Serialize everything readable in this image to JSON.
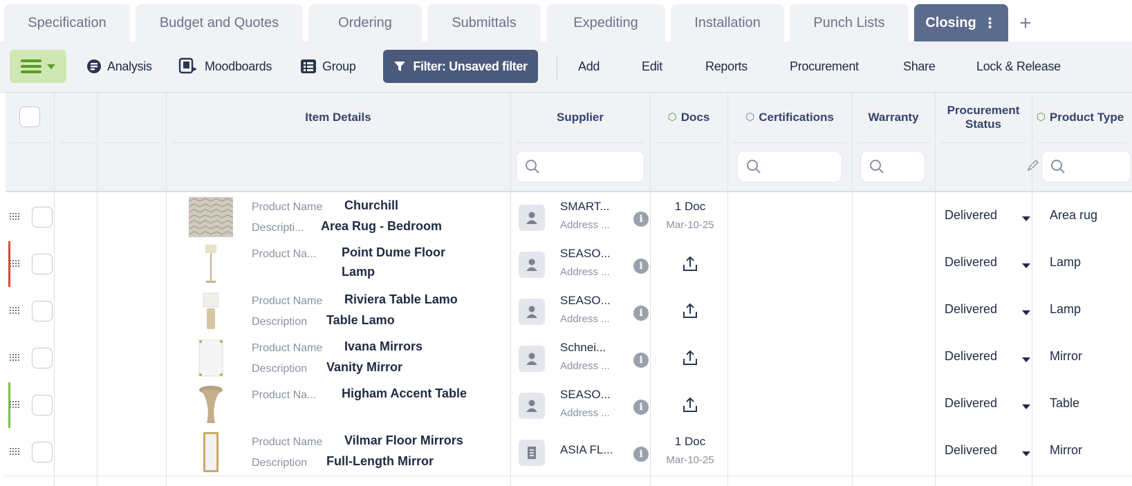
{
  "tabs": [
    {
      "label": "Specification"
    },
    {
      "label": "Budget and Quotes"
    },
    {
      "label": "Ordering"
    },
    {
      "label": "Submittals"
    },
    {
      "label": "Expediting"
    },
    {
      "label": "Installation"
    },
    {
      "label": "Punch Lists"
    },
    {
      "label": "Closing",
      "active": true
    }
  ],
  "tab_menu_glyph": "⋮",
  "add_tab_glyph": "+",
  "toolbar": {
    "analysis": "Analysis",
    "moodboards": "Moodboards",
    "group": "Group",
    "filter": "Filter: Unsaved filter",
    "add": "Add",
    "edit": "Edit",
    "reports": "Reports",
    "procurement": "Procurement",
    "share": "Share",
    "lock_release": "Lock & Release"
  },
  "columns": {
    "item_details": "Item Details",
    "supplier": "Supplier",
    "docs": "Docs",
    "certifications": "Certifications",
    "warranty": "Warranty",
    "procurement_status": "Procurement Status",
    "product_type": "Product Type"
  },
  "rows": [
    {
      "name_label": "Product Name",
      "name": "Churchill",
      "desc_label": "Descripti...",
      "desc": "Area Rug - Bedroom",
      "supplier": "SMART...",
      "supplier_addr": "Address ...",
      "supplier_icon": "person-icon",
      "doc_count": "1 Doc",
      "doc_date": "Mar-10-25",
      "status": "Delivered",
      "type": "Area rug",
      "accent": "",
      "thumb": "rug"
    },
    {
      "name_label": "Product Na...",
      "name": "Point Dume Floor Lamp",
      "desc_label": "",
      "desc": "",
      "supplier": "SEASO...",
      "supplier_addr": "Address ...",
      "supplier_icon": "person-icon",
      "doc_count": "",
      "doc_date": "",
      "status": "Delivered",
      "type": "Lamp",
      "accent": "#e0463a",
      "thumb": "floorlamp"
    },
    {
      "name_label": "Product Name",
      "name": "Riviera Table Lamo",
      "desc_label": "Description",
      "desc": "Table Lamo",
      "supplier": "SEASO...",
      "supplier_addr": "Address ...",
      "supplier_icon": "person-icon",
      "doc_count": "",
      "doc_date": "",
      "status": "Delivered",
      "type": "Lamp",
      "accent": "",
      "thumb": "tablelamp"
    },
    {
      "name_label": "Product Name",
      "name": "Ivana Mirrors",
      "desc_label": "Description",
      "desc": "Vanity Mirror",
      "supplier": "Schnei...",
      "supplier_addr": "Address ...",
      "supplier_icon": "person-icon",
      "doc_count": "",
      "doc_date": "",
      "status": "Delivered",
      "type": "Mirror",
      "accent": "",
      "thumb": "mirror"
    },
    {
      "name_label": "Product Na...",
      "name": "Higham Accent Table",
      "desc_label": "",
      "desc": "",
      "supplier": "SEASO...",
      "supplier_addr": "Address ...",
      "supplier_icon": "person-icon",
      "doc_count": "",
      "doc_date": "",
      "status": "Delivered",
      "type": "Table",
      "accent": "#7cc04a",
      "thumb": "table"
    },
    {
      "name_label": "Product Name",
      "name": "Vilmar Floor Mirrors",
      "desc_label": "Description",
      "desc": "Full-Length Mirror",
      "supplier": "ASIA FL...",
      "supplier_addr": "",
      "supplier_icon": "building-icon",
      "doc_count": "1 Doc",
      "doc_date": "Mar-10-25",
      "status": "Delivered",
      "type": "Mirror",
      "accent": "",
      "thumb": "floormirror"
    }
  ],
  "colors": {
    "active_tab": "#5b6b8c",
    "filter_button": "#4a5a7c",
    "menu_button": "#cfe8b3",
    "header_text": "#33436a",
    "accent_red": "#e0463a",
    "accent_green": "#7cc04a"
  }
}
